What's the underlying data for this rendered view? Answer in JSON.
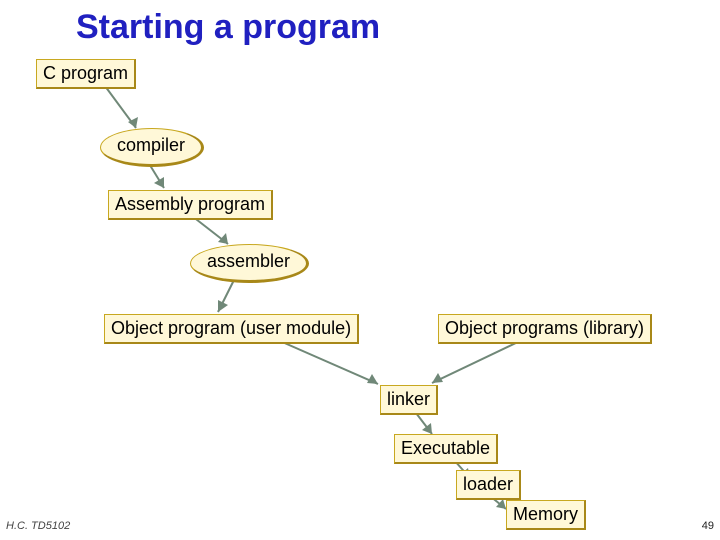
{
  "title": "Starting a program",
  "nodes": {
    "c_program": "C program",
    "compiler": "compiler",
    "assembly": "Assembly program",
    "assembler": "assembler",
    "obj_user": "Object program (user module)",
    "obj_lib": "Object programs (library)",
    "linker": "linker",
    "executable": "Executable",
    "loader": "loader",
    "memory": "Memory"
  },
  "footer": {
    "left": "H.C. TD5102",
    "right": "49"
  }
}
